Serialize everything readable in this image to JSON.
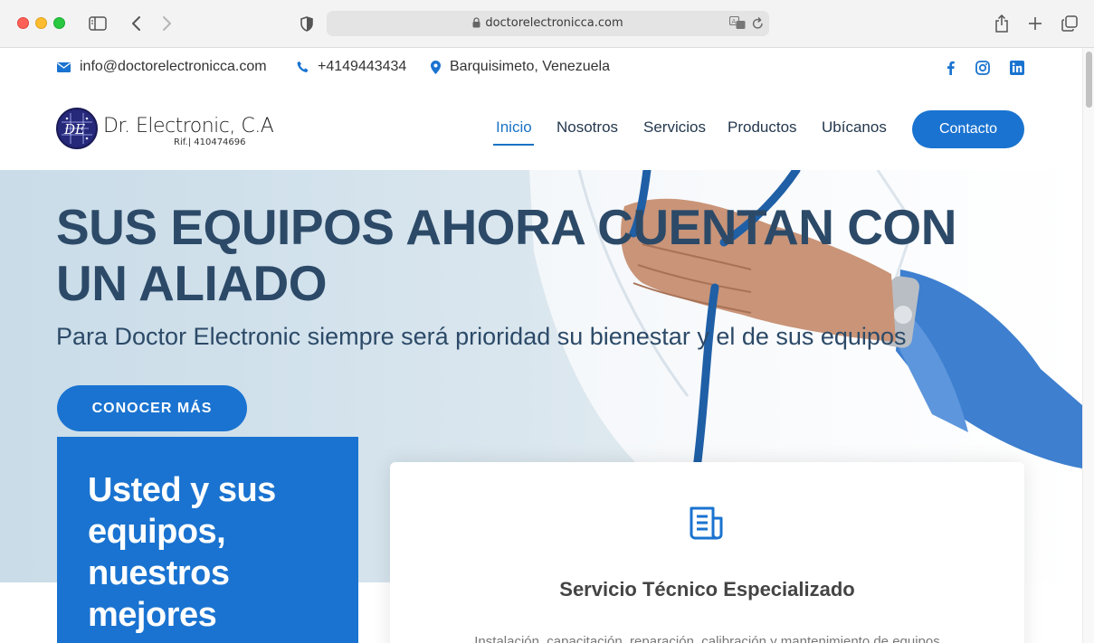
{
  "browser": {
    "url": "doctorelectronicca.com"
  },
  "topbar": {
    "email": "info@doctorelectronicca.com",
    "phone": "+4149443434",
    "location": "Barquisimeto, Venezuela",
    "social": [
      "facebook-icon",
      "instagram-icon",
      "linkedin-icon"
    ]
  },
  "header": {
    "logo_name": "Dr. Electronic, C.A",
    "logo_rif": "Rif.| 410474696",
    "nav": [
      "Inicio",
      "Nosotros",
      "Servicios",
      "Productos",
      "Ubícanos"
    ],
    "active_nav": "Inicio",
    "contact_label": "Contacto"
  },
  "hero": {
    "title": "SUS EQUIPOS AHORA CUENTAN CON UN ALIADO",
    "subtitle": "Para Doctor Electronic siempre será prioridad su bienestar y el de sus equipos",
    "cta_label": "CONOCER MÁS"
  },
  "promo": {
    "text": "Usted y sus equipos, nuestros mejores"
  },
  "service_card": {
    "icon": "document-icon",
    "title": "Servicio Técnico Especializado",
    "text": "Instalación, capacitación, reparación, calibración y mantenimiento de equipos"
  },
  "colors": {
    "brand_blue": "#1a73d0",
    "heading_navy": "#2c4a68"
  }
}
